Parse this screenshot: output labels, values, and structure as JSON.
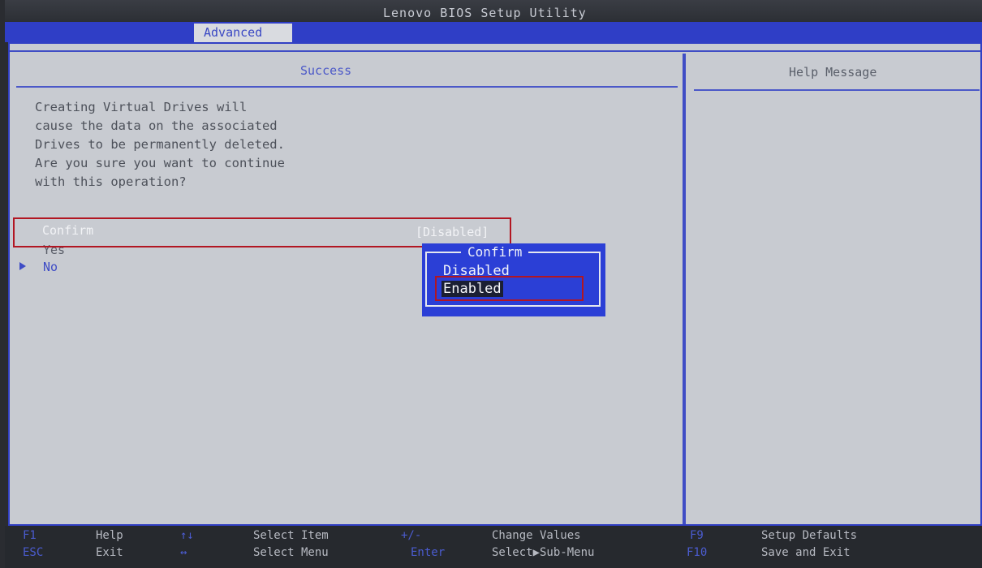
{
  "app": {
    "title": "Lenovo BIOS Setup Utility"
  },
  "tabs": [
    {
      "label": "Advanced"
    }
  ],
  "main": {
    "section_title": "Success",
    "warning_text": "Creating Virtual Drives will\ncause the data on the associated\nDrives to be permanently deleted.\nAre you sure you want to continue\nwith this operation?",
    "confirm": {
      "label": "Confirm",
      "value": "[Disabled]"
    },
    "options": [
      {
        "label": "Yes"
      },
      {
        "label": "No"
      }
    ]
  },
  "help": {
    "title": "Help Message"
  },
  "popup": {
    "title": "Confirm",
    "options": [
      {
        "label": "Disabled"
      },
      {
        "label": "Enabled"
      }
    ],
    "selected": "Enabled"
  },
  "footer": {
    "items": [
      {
        "key": "F1",
        "label": "Help"
      },
      {
        "key": "ESC",
        "label": "Exit"
      },
      {
        "key": "↑↓",
        "label": "Select Item"
      },
      {
        "key": "↔",
        "label": "Select Menu"
      },
      {
        "key": "+/-",
        "label": "Change Values"
      },
      {
        "key": "Enter",
        "label": "Select▶Sub-Menu"
      },
      {
        "key": "F9",
        "label": "Setup Defaults"
      },
      {
        "key": "F10",
        "label": "Save and Exit"
      }
    ]
  },
  "colors": {
    "accent": "#2f3ec6",
    "background": "#c8cbd1",
    "highlight": "#b21622"
  }
}
